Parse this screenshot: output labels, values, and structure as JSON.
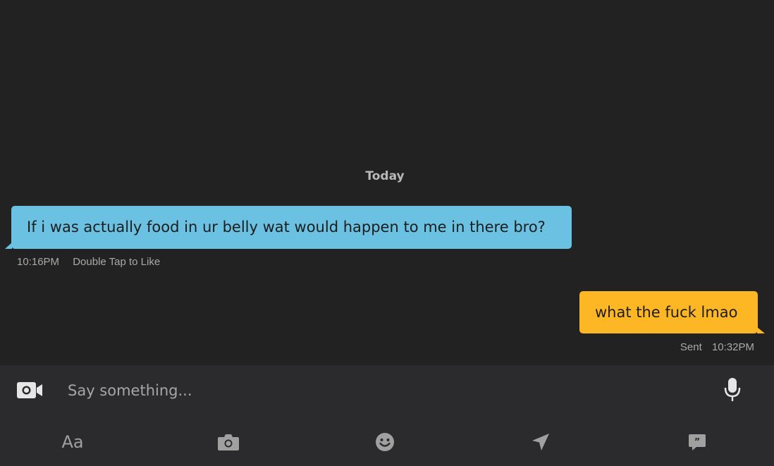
{
  "chat": {
    "day_label": "Today",
    "messages": [
      {
        "direction": "incoming",
        "text": "If i was actually food in ur belly wat would happen to me in there bro?",
        "time": "10:16PM",
        "hint": "Double Tap to Like",
        "bubble_color": "#6bc1e2"
      },
      {
        "direction": "outgoing",
        "text": "what the fuck lmao",
        "status": "Sent",
        "time": "10:32PM",
        "bubble_color": "#fdb724"
      }
    ]
  },
  "composer": {
    "placeholder": "Say something...",
    "value": "",
    "left_icon": "video-camera-icon",
    "right_icon": "microphone-icon"
  },
  "toolbar": {
    "format_label": "Aa",
    "items": [
      "format-text",
      "camera-icon",
      "emoji-icon",
      "location-arrow-icon",
      "saved-phrases-icon"
    ]
  },
  "colors": {
    "background": "#222222",
    "bar": "#2b2b2d",
    "icon": "#a0a0a0",
    "incoming": "#6bc1e2",
    "outgoing": "#fdb724"
  }
}
